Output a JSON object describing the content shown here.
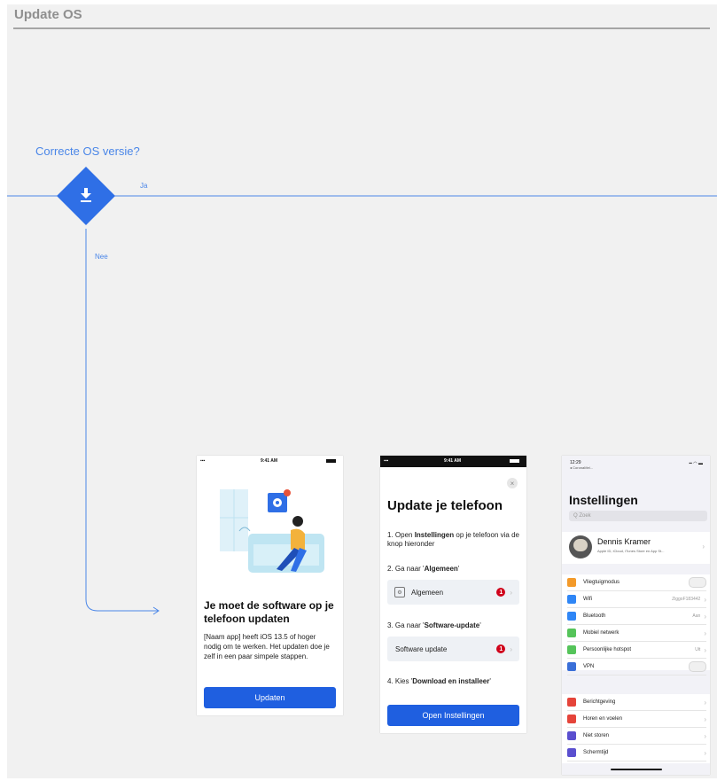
{
  "flow": {
    "title": "Update OS",
    "decision_label": "Correcte OS versie?",
    "yes_label": "Ja",
    "no_label": "Nee",
    "decision_icon": "download-icon",
    "line_color": "#4a86e8"
  },
  "screen1": {
    "status_time": "9:41 AM",
    "heading": "Je moet de software op je telefoon updaten",
    "body": "[Naam app] heeft iOS 13.5 of hoger nodig om te werken. Het updaten doe je zelf in een paar simpele stappen.",
    "button": "Updaten"
  },
  "screen2": {
    "status_time": "9:41 AM",
    "heading": "Update je telefoon",
    "step1_prefix": "1. Open ",
    "step1_bold": "Instellingen",
    "step1_suffix": " op je telefoon via de knop hieronder",
    "step2_prefix": "2. Ga naar '",
    "step2_bold": "Algemeen",
    "step2_suffix": "'",
    "row1": "Algemeen",
    "row1_badge": "1",
    "step3_prefix": "3. Ga naar '",
    "step3_bold": "Software-update",
    "step3_suffix": "'",
    "row2": "Software update",
    "row2_badge": "1",
    "step4_prefix": "4. Kies '",
    "step4_bold": "Download en installeer",
    "step4_suffix": "'",
    "button": "Open Instellingen"
  },
  "screen3": {
    "status_time": "12:29",
    "status_back": "◂ CoronaMel...",
    "heading": "Instellingen",
    "search_placeholder": "Q Zoek",
    "profile_name": "Dennis Kramer",
    "profile_sub": "Apple ID, iCloud, iTunes Store en App St...",
    "group1": [
      {
        "label": "Vliegtuigmodus",
        "value": "",
        "icon_color": "#f39a2a",
        "toggle": true
      },
      {
        "label": "Wifi",
        "value": "ZiggoF183442",
        "icon_color": "#2f86f6",
        "toggle": false
      },
      {
        "label": "Bluetooth",
        "value": "Aan",
        "icon_color": "#2f86f6",
        "toggle": false
      },
      {
        "label": "Mobiel netwerk",
        "value": "",
        "icon_color": "#55c45a",
        "toggle": false
      },
      {
        "label": "Persoonlijke hotspot",
        "value": "Uit",
        "icon_color": "#55c45a",
        "toggle": false
      },
      {
        "label": "VPN",
        "value": "",
        "icon_color": "#3a6fd8",
        "toggle": true
      }
    ],
    "group2": [
      {
        "label": "Berichtgeving",
        "value": "",
        "icon_color": "#e5443a",
        "toggle": false
      },
      {
        "label": "Horen en voelen",
        "value": "",
        "icon_color": "#e5443a",
        "toggle": false
      },
      {
        "label": "Niet storen",
        "value": "",
        "icon_color": "#5a4fcf",
        "toggle": false
      },
      {
        "label": "Schermtijd",
        "value": "",
        "icon_color": "#5a4fcf",
        "toggle": false
      }
    ]
  }
}
